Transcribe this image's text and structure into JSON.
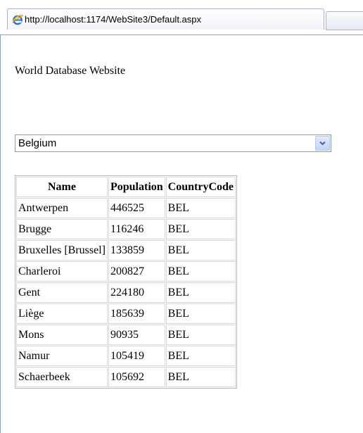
{
  "browser": {
    "tab_url": "http://localhost:1174/WebSite3/Default.aspx",
    "tab_icon": "ie-icon"
  },
  "page": {
    "title": "World Database Website"
  },
  "country_select": {
    "selected": "Belgium",
    "arrow_icon": "chevron-down-icon"
  },
  "city_table": {
    "columns": [
      "Name",
      "Population",
      "CountryCode"
    ],
    "rows": [
      [
        "Antwerpen",
        "446525",
        "BEL"
      ],
      [
        "Brugge",
        "116246",
        "BEL"
      ],
      [
        "Bruxelles [Brussel]",
        "133859",
        "BEL"
      ],
      [
        "Charleroi",
        "200827",
        "BEL"
      ],
      [
        "Gent",
        "224180",
        "BEL"
      ],
      [
        "Liège",
        "185639",
        "BEL"
      ],
      [
        "Mons",
        "90935",
        "BEL"
      ],
      [
        "Namur",
        "105419",
        "BEL"
      ],
      [
        "Schaerbeek",
        "105692",
        "BEL"
      ]
    ]
  }
}
